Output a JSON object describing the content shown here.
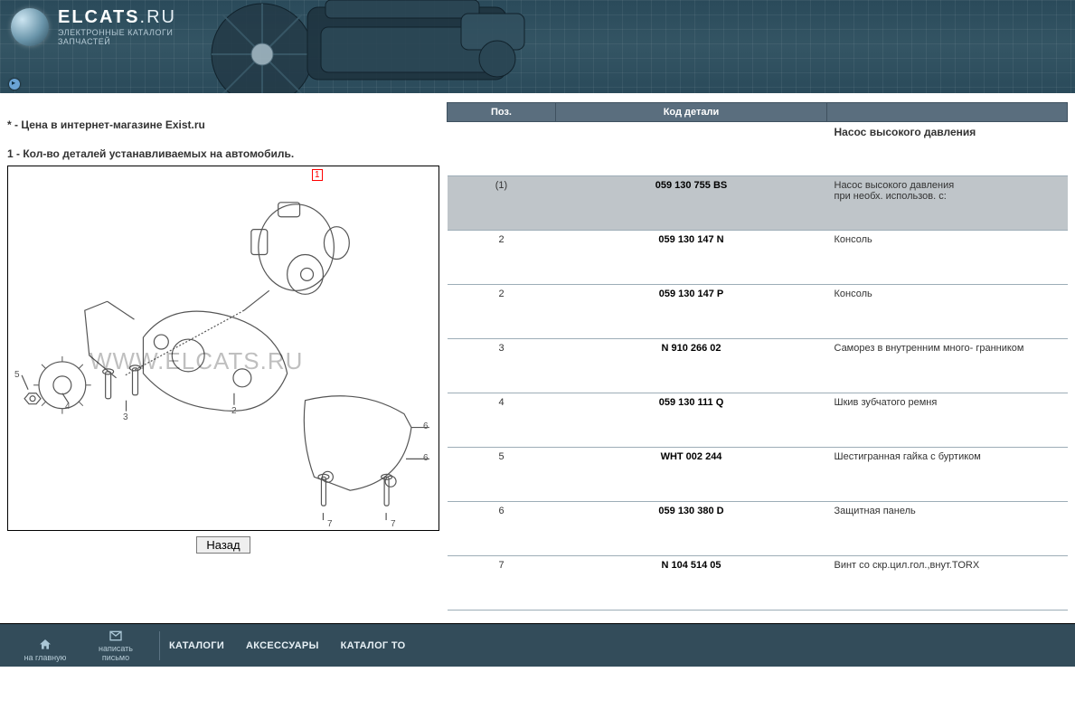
{
  "header": {
    "brand_main": "ELCATS",
    "brand_suffix": ".RU",
    "subtitle1": "ЭЛЕКТРОННЫЕ КАТАЛОГИ",
    "subtitle2": "ЗАПЧАСТЕЙ"
  },
  "legend": {
    "line1_prefix": "*",
    "line1_text": " - Цена в интернет-магазине Exist.ru",
    "line2_prefix": "1",
    "line2_text": " - Кол-во деталей устанавливаемых на автомобиль."
  },
  "diagram": {
    "watermark": "WWW.ELCATS.RU",
    "callouts": {
      "red1": "1",
      "c2": "2",
      "c3": "3",
      "c4": "4",
      "c5": "5",
      "c6a": "6",
      "c6b": "6",
      "c7a": "7",
      "c7b": "7"
    }
  },
  "back_button": "Назад",
  "table": {
    "headers": {
      "pos": "Поз.",
      "code": "Код детали",
      "desc": ""
    },
    "section_title": "Насос высокого давления",
    "rows": [
      {
        "pos": "(1)",
        "code": "059 130 755 BS",
        "desc": "Насос высокого давления\nпри необх. использов. с:",
        "selected": true
      },
      {
        "pos": "2",
        "code": "059 130 147 N",
        "desc": "Консоль"
      },
      {
        "pos": "2",
        "code": "059 130 147 P",
        "desc": "Консоль"
      },
      {
        "pos": "3",
        "code": "N  910 266 02",
        "desc": "Саморез в внутренним много- гранником"
      },
      {
        "pos": "4",
        "code": "059 130 111 Q",
        "desc": "Шкив зубчатого ремня"
      },
      {
        "pos": "5",
        "code": "WHT 002 244",
        "desc": "Шестигранная гайка с буртиком"
      },
      {
        "pos": "6",
        "code": "059 130 380 D",
        "desc": "Защитная панель"
      },
      {
        "pos": "7",
        "code": "N  104 514 05",
        "desc": "Винт со скр.цил.гол.,внут.TORX"
      }
    ]
  },
  "footer": {
    "home": "на главную",
    "mail": "написать письмо",
    "links": [
      "КАТАЛОГИ",
      "АКСЕССУАРЫ",
      "КАТАЛОГ ТО"
    ]
  }
}
